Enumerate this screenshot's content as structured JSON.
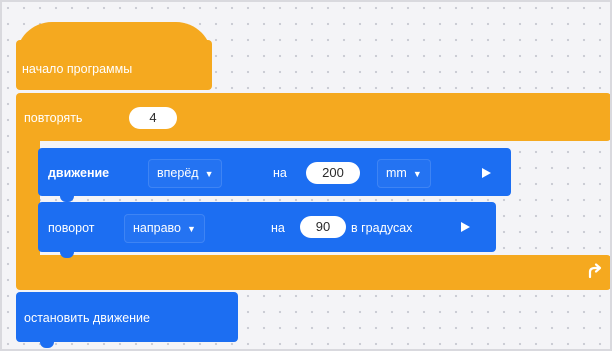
{
  "start_block": {
    "label": "начало программы"
  },
  "repeat_block": {
    "label": "повторять",
    "count": "4"
  },
  "move_block": {
    "label": "движение",
    "direction": "вперёд",
    "on_label": "на",
    "distance": "200",
    "unit": "mm"
  },
  "turn_block": {
    "label": "поворот",
    "direction": "направо",
    "on_label": "на",
    "angle": "90",
    "unit_label": "в градусах"
  },
  "stop_block": {
    "label": "остановить движение"
  },
  "colors": {
    "events": "#f5a91f",
    "motion": "#1c6ef2",
    "canvas": "#f4f4f7"
  },
  "icons": {
    "dropdown": "chevron-down-icon",
    "run": "play-icon",
    "loop": "loop-arrow-icon"
  }
}
